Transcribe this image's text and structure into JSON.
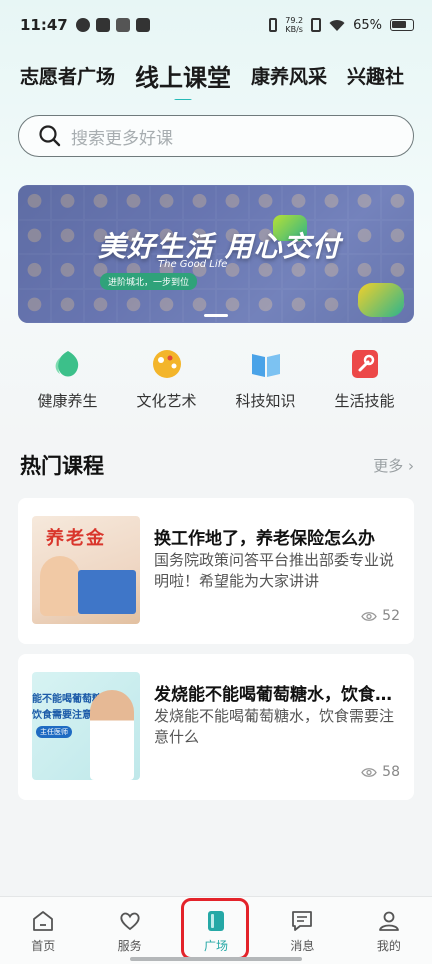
{
  "status_bar": {
    "time": "11:47",
    "net_speed_value": "79.2",
    "net_speed_unit": "KB/s",
    "battery": "65%"
  },
  "tabs": [
    {
      "label": "志愿者广场",
      "active": false
    },
    {
      "label": "线上课堂",
      "active": true
    },
    {
      "label": "康养风采",
      "active": false
    },
    {
      "label": "兴趣社",
      "active": false
    }
  ],
  "search": {
    "placeholder": "搜索更多好课"
  },
  "banner": {
    "title": "美好生活 用心交付",
    "subtitle_en": "The Good Life",
    "subtitle": "进阶城北，一步到位"
  },
  "categories": [
    {
      "label": "健康养生",
      "icon": "leaf-icon",
      "color": "#3cc08a"
    },
    {
      "label": "文化艺术",
      "icon": "palette-icon",
      "color": "#f3b52b"
    },
    {
      "label": "科技知识",
      "icon": "book-icon",
      "color": "#4aa3e8"
    },
    {
      "label": "生活技能",
      "icon": "wrench-icon",
      "color": "#ec4848"
    }
  ],
  "hot_courses": {
    "title": "热门课程",
    "more": "更多",
    "items": [
      {
        "title": "换工作地了，养老保险怎么办",
        "desc": "国务院政策问答平台推出部委专业说明啦！希望能为大家讲讲",
        "views": "52",
        "thumb_text": "养老金"
      },
      {
        "title": "发烧能不能喝葡萄糖水，饮食需要注意什么",
        "desc": "发烧能不能喝葡萄糖水，饮食需要注意什么",
        "views": "58",
        "thumb_line1": "能不能喝葡萄糖",
        "thumb_line2": "饮食需要注意什么",
        "thumb_tag": "主任医师"
      }
    ]
  },
  "bottom_nav": [
    {
      "label": "首页",
      "icon": "home-icon",
      "active": false
    },
    {
      "label": "服务",
      "icon": "heart-icon",
      "active": false
    },
    {
      "label": "广场",
      "icon": "square-book-icon",
      "active": true
    },
    {
      "label": "消息",
      "icon": "message-icon",
      "active": false
    },
    {
      "label": "我的",
      "icon": "user-icon",
      "active": false
    }
  ],
  "colors": {
    "accent": "#25b9b6",
    "highlight": "#e3232a"
  }
}
